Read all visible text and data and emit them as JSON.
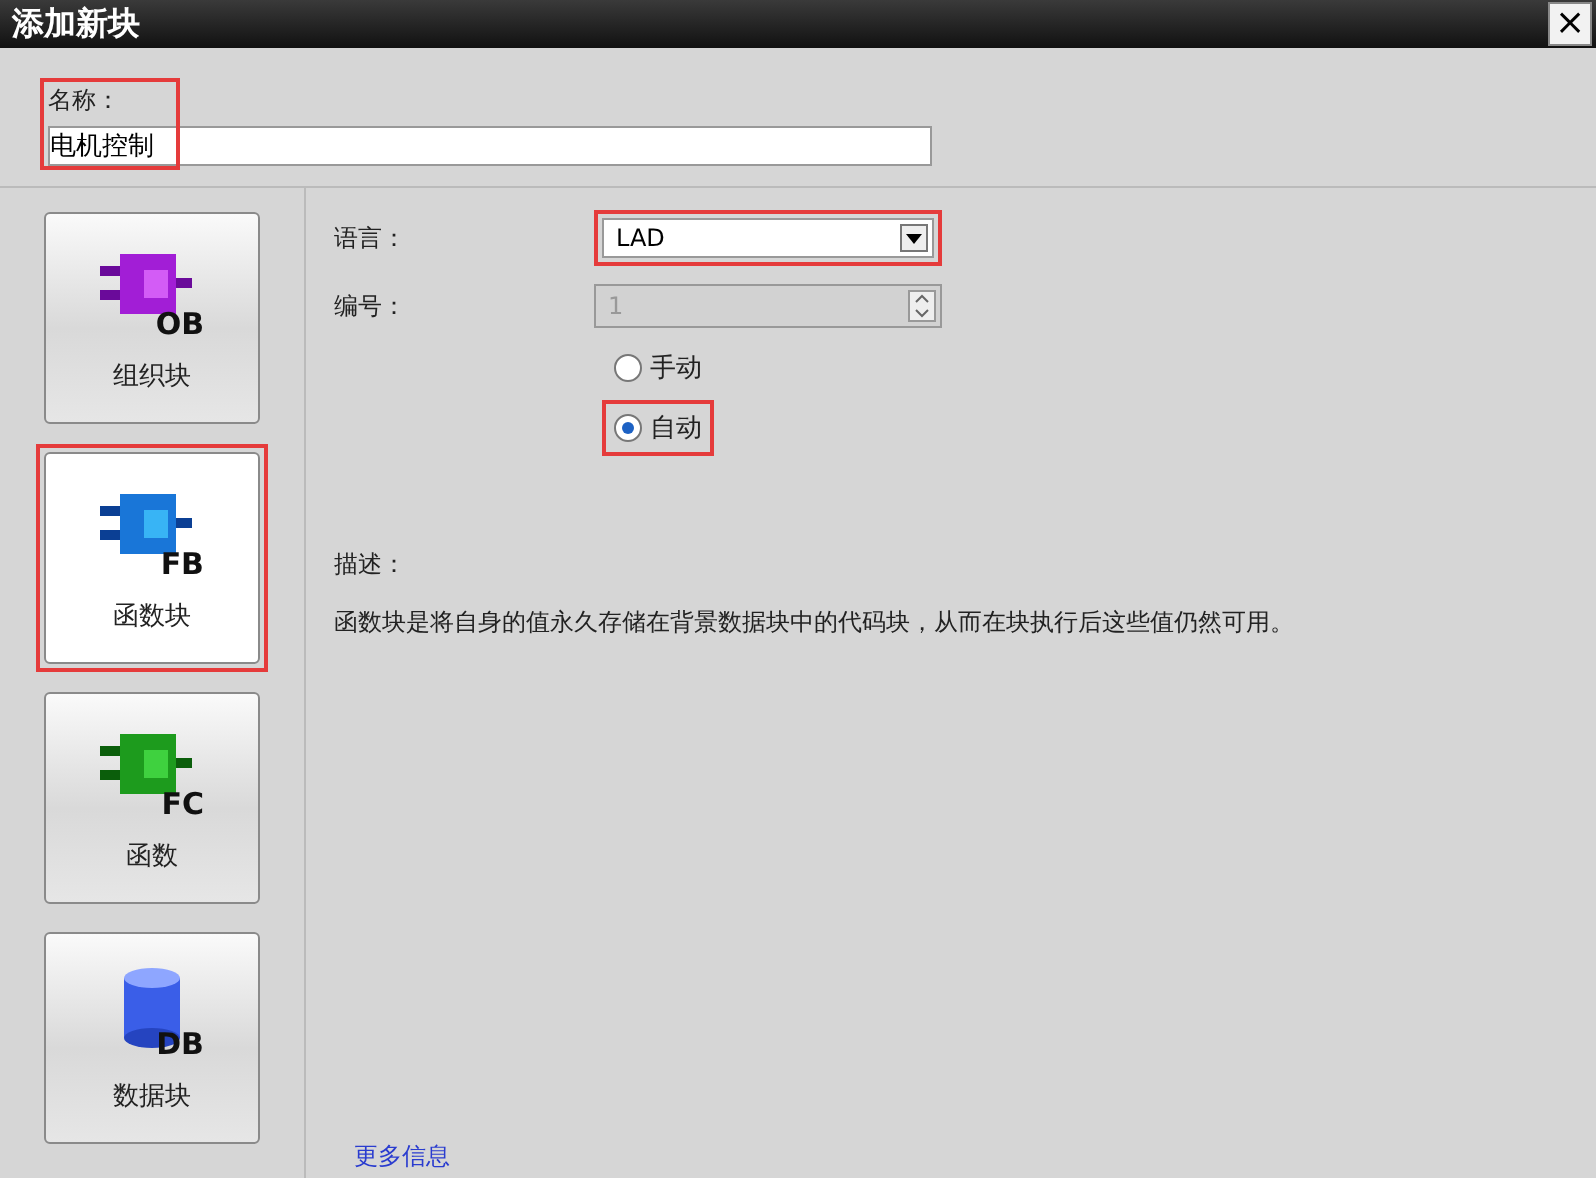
{
  "window": {
    "title": "添加新块",
    "close": "×"
  },
  "name_field": {
    "label": "名称：",
    "value": "电机控制",
    "highlighted": true
  },
  "block_types": [
    {
      "kind": "ob",
      "label": "组织块",
      "code": "OB",
      "selected": false,
      "highlighted": false
    },
    {
      "kind": "fb",
      "label": "函数块",
      "code": "FB",
      "selected": true,
      "highlighted": true
    },
    {
      "kind": "fc",
      "label": "函数",
      "code": "FC",
      "selected": false,
      "highlighted": false
    },
    {
      "kind": "db",
      "label": "数据块",
      "code": "DB",
      "selected": false,
      "highlighted": false
    }
  ],
  "language": {
    "label": "语言：",
    "value": "LAD",
    "highlighted": true
  },
  "number": {
    "label": "编号：",
    "value": "1",
    "disabled": true
  },
  "numbering_modes": [
    {
      "label": "手动",
      "selected": false,
      "highlighted": false
    },
    {
      "label": "自动",
      "selected": true,
      "highlighted": true
    }
  ],
  "description": {
    "label": "描述：",
    "text": "函数块是将自身的值永久存储在背景数据块中的代码块，从而在块执行后这些值仍然可用。"
  },
  "more_info_link": "更多信息"
}
